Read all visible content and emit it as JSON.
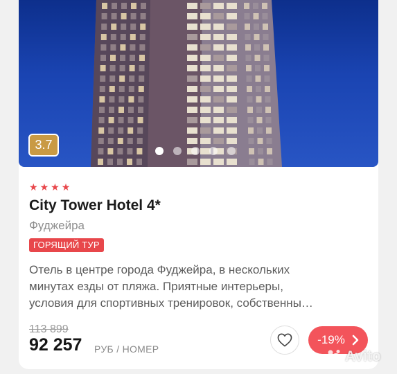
{
  "listing": {
    "rating": "3.7",
    "stars_count": 4,
    "name": "City Tower Hotel 4*",
    "location": "Фуджейра",
    "badge": "ГОРЯЩИЙ ТУР",
    "description_lines": [
      "Отель в центре города Фуджейра, в нескольких",
      "минутах езды от пляжа. Приятные интерьеры,",
      "условия для спортивных тренировок, собственны…"
    ],
    "old_price": "113 899",
    "price": "92 257",
    "price_unit": "РУБ / НОМЕР",
    "discount": "-19%"
  },
  "gallery": {
    "total_slides": 5,
    "active_slide": 1
  },
  "watermark": {
    "text": "Avito"
  },
  "colors": {
    "accent_red": "#f3545b",
    "star_red": "#e8474b",
    "rating_gold": "#c99a44",
    "sky_blue": "#1a44b2"
  },
  "icons": {
    "favorite": "heart-icon",
    "next": "chevron-right-icon",
    "star": "star-icon"
  }
}
